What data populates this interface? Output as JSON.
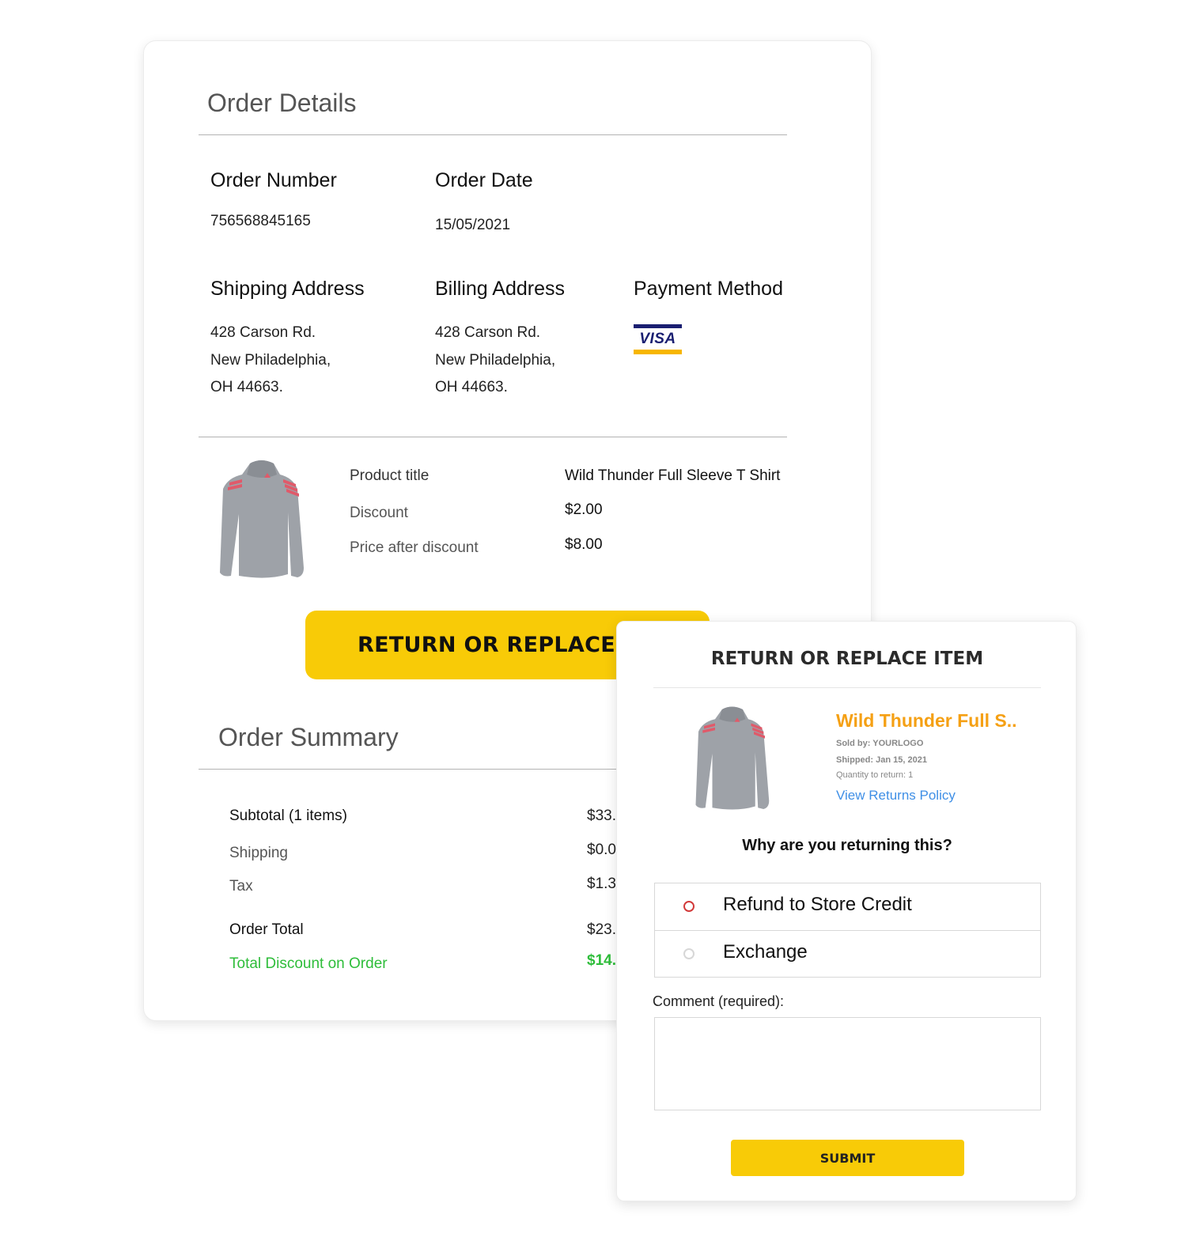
{
  "order_details": {
    "title": "Order Details",
    "order_number": {
      "label": "Order Number",
      "value": "756568845165"
    },
    "order_date": {
      "label": "Order Date",
      "value": "15/05/2021"
    },
    "shipping_address": {
      "label": "Shipping Address",
      "lines": [
        "428 Carson Rd.",
        "New Philadelphia,",
        "OH 44663."
      ]
    },
    "billing_address": {
      "label": "Billing Address",
      "lines": [
        "428 Carson Rd.",
        "New Philadelphia,",
        "OH 44663."
      ]
    },
    "payment_method": {
      "label": "Payment Method",
      "card_brand": "VISA",
      "card_icon": "visa-card-icon"
    }
  },
  "product": {
    "image_icon": "hoodie-jacket-image",
    "rows": [
      {
        "label": "Product title",
        "value": "Wild Thunder Full Sleeve T Shirt"
      },
      {
        "label": "Discount",
        "value": "$2.00"
      },
      {
        "label": "Price after discount",
        "value": "$8.00"
      }
    ],
    "return_button_label": "RETURN OR REPLACE ITEM"
  },
  "order_summary": {
    "title": "Order Summary",
    "rows": [
      {
        "label": "Subtotal (1 items)",
        "value": "$33."
      },
      {
        "label": "Shipping",
        "value": "$0.0"
      },
      {
        "label": "Tax",
        "value": "$1.3"
      },
      {
        "label": "Order Total",
        "value": "$23."
      },
      {
        "label": "Total Discount on Order",
        "value": "$14."
      }
    ]
  },
  "return_modal": {
    "title": "RETURN OR REPLACE ITEM",
    "product_title": "Wild Thunder Full S..",
    "sold_by": "Sold by: YOURLOGO",
    "shipped": "Shipped: Jan 15, 2021",
    "quantity": "Quantity to return: 1",
    "policy_link": "View Returns Policy",
    "question": "Why are you returning this?",
    "options": [
      {
        "label": "Refund to Store Credit",
        "selected": true
      },
      {
        "label": "Exchange",
        "selected": false
      }
    ],
    "comment_label": "Comment (required):",
    "comment_value": "",
    "submit_label": "SUBMIT"
  },
  "colors": {
    "accent_yellow": "#f8cb07",
    "product_title_orange": "#f5a014",
    "link_blue": "#3f8fe6",
    "discount_green": "#2ebd3a",
    "radio_selected_red": "#d23a3a"
  }
}
